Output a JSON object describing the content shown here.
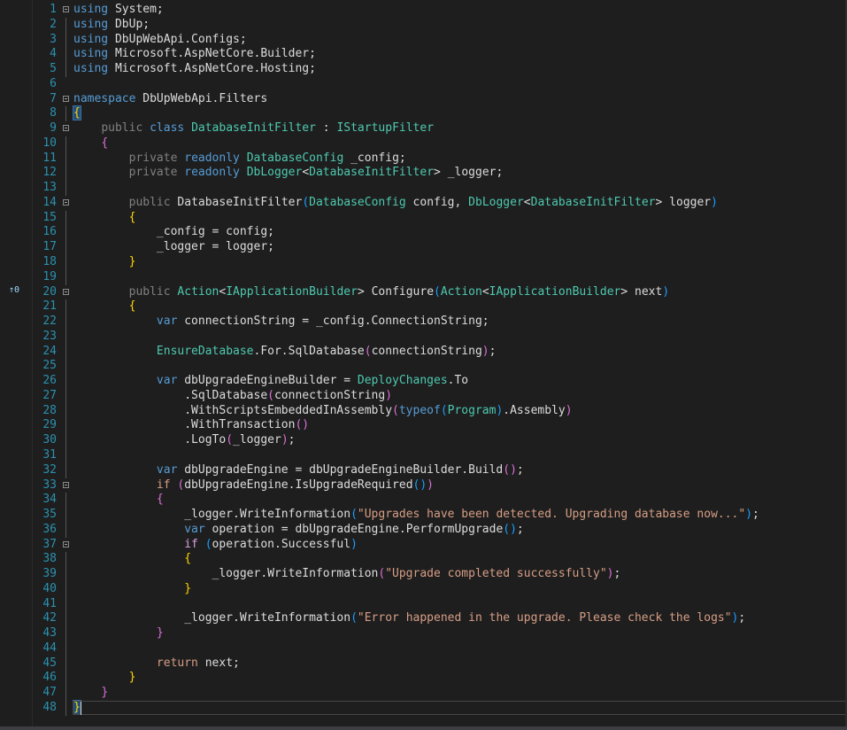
{
  "editor": {
    "bookmark_glyph": "↑0",
    "lines": [
      {
        "n": "1"
      },
      {
        "n": "2"
      },
      {
        "n": "3"
      },
      {
        "n": "4"
      },
      {
        "n": "5"
      },
      {
        "n": "6"
      },
      {
        "n": "7"
      },
      {
        "n": "8"
      },
      {
        "n": "9"
      },
      {
        "n": "10"
      },
      {
        "n": "11"
      },
      {
        "n": "12"
      },
      {
        "n": "13"
      },
      {
        "n": "14"
      },
      {
        "n": "15"
      },
      {
        "n": "16"
      },
      {
        "n": "17"
      },
      {
        "n": "18"
      },
      {
        "n": "19"
      },
      {
        "n": "20"
      },
      {
        "n": "21"
      },
      {
        "n": "22"
      },
      {
        "n": "23"
      },
      {
        "n": "24"
      },
      {
        "n": "25"
      },
      {
        "n": "26"
      },
      {
        "n": "27"
      },
      {
        "n": "28"
      },
      {
        "n": "29"
      },
      {
        "n": "30"
      },
      {
        "n": "31"
      },
      {
        "n": "32"
      },
      {
        "n": "33"
      },
      {
        "n": "34"
      },
      {
        "n": "35"
      },
      {
        "n": "36"
      },
      {
        "n": "37"
      },
      {
        "n": "38"
      },
      {
        "n": "39"
      },
      {
        "n": "40"
      },
      {
        "n": "41"
      },
      {
        "n": "42"
      },
      {
        "n": "43"
      },
      {
        "n": "44"
      },
      {
        "n": "45"
      },
      {
        "n": "46"
      },
      {
        "n": "47"
      },
      {
        "n": "48"
      }
    ],
    "tokens": {
      "using": "using",
      "ns_system": " System;",
      "ns_dbup": " DbUp;",
      "ns_configs": " DbUpWebApi.Configs;",
      "ns_builder": " Microsoft.AspNetCore.Builder;",
      "ns_hosting": " Microsoft.AspNetCore.Hosting;",
      "namespace": "namespace",
      "ns_filters": " DbUpWebApi.Filters",
      "public": "public",
      "class": "class",
      "private": "private",
      "readonly": "readonly",
      "var": "var",
      "if": "if",
      "return": "return",
      "typeof": "typeof",
      "t_DatabaseInitFilter": "DatabaseInitFilter",
      "t_IStartupFilter": "IStartupFilter",
      "t_DatabaseConfig": "DatabaseConfig",
      "t_DbLogger": "DbLogger",
      "t_Action": "Action",
      "t_IApplicationBuilder": "IApplicationBuilder",
      "t_EnsureDatabase": "EnsureDatabase",
      "t_DeployChanges": "DeployChanges",
      "t_Program": "Program",
      "s1": "\"Upgrades have been detected. Upgrading database now...\"",
      "s2": "\"Upgrade completed successfully\"",
      "s3": "\"Error happened in the upgrade. Please check the logs\""
    }
  }
}
